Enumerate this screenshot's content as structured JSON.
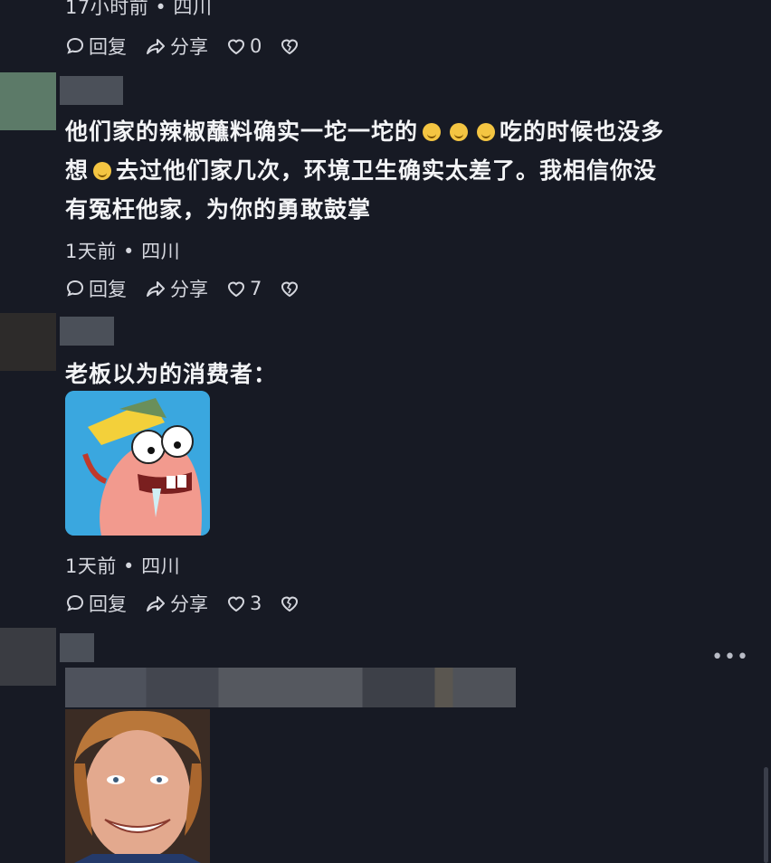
{
  "top_meta": "17小时前 • 四川",
  "actions_labels": {
    "reply": "回复",
    "share": "分享"
  },
  "comments": [
    {
      "likes": "0"
    },
    {
      "text_line1": "他们家的辣椒蘸料确实一坨一坨的",
      "text_line1b": "吃的时候也没多",
      "text_line2a": "想",
      "text_line2b": "去过他们家几次，环境卫生确实太差了。我相信你没",
      "text_line3": "有冤枉他家，为你的勇敢鼓掌",
      "meta": "1天前 • 四川",
      "likes": "7",
      "avatar_color": "#5c7a68"
    },
    {
      "text": "老板以为的消费者：",
      "meta": "1天前 • 四川",
      "likes": "3",
      "avatar_color": "#2d2b2a",
      "image": "cartoon-character-meme"
    },
    {
      "more": "•••",
      "avatar_color": "#3a3c42",
      "image": "smiling-man-photo"
    }
  ],
  "colors": {
    "background": "#171a24",
    "text": "#f3f4f6",
    "meta": "#d5d7de"
  }
}
